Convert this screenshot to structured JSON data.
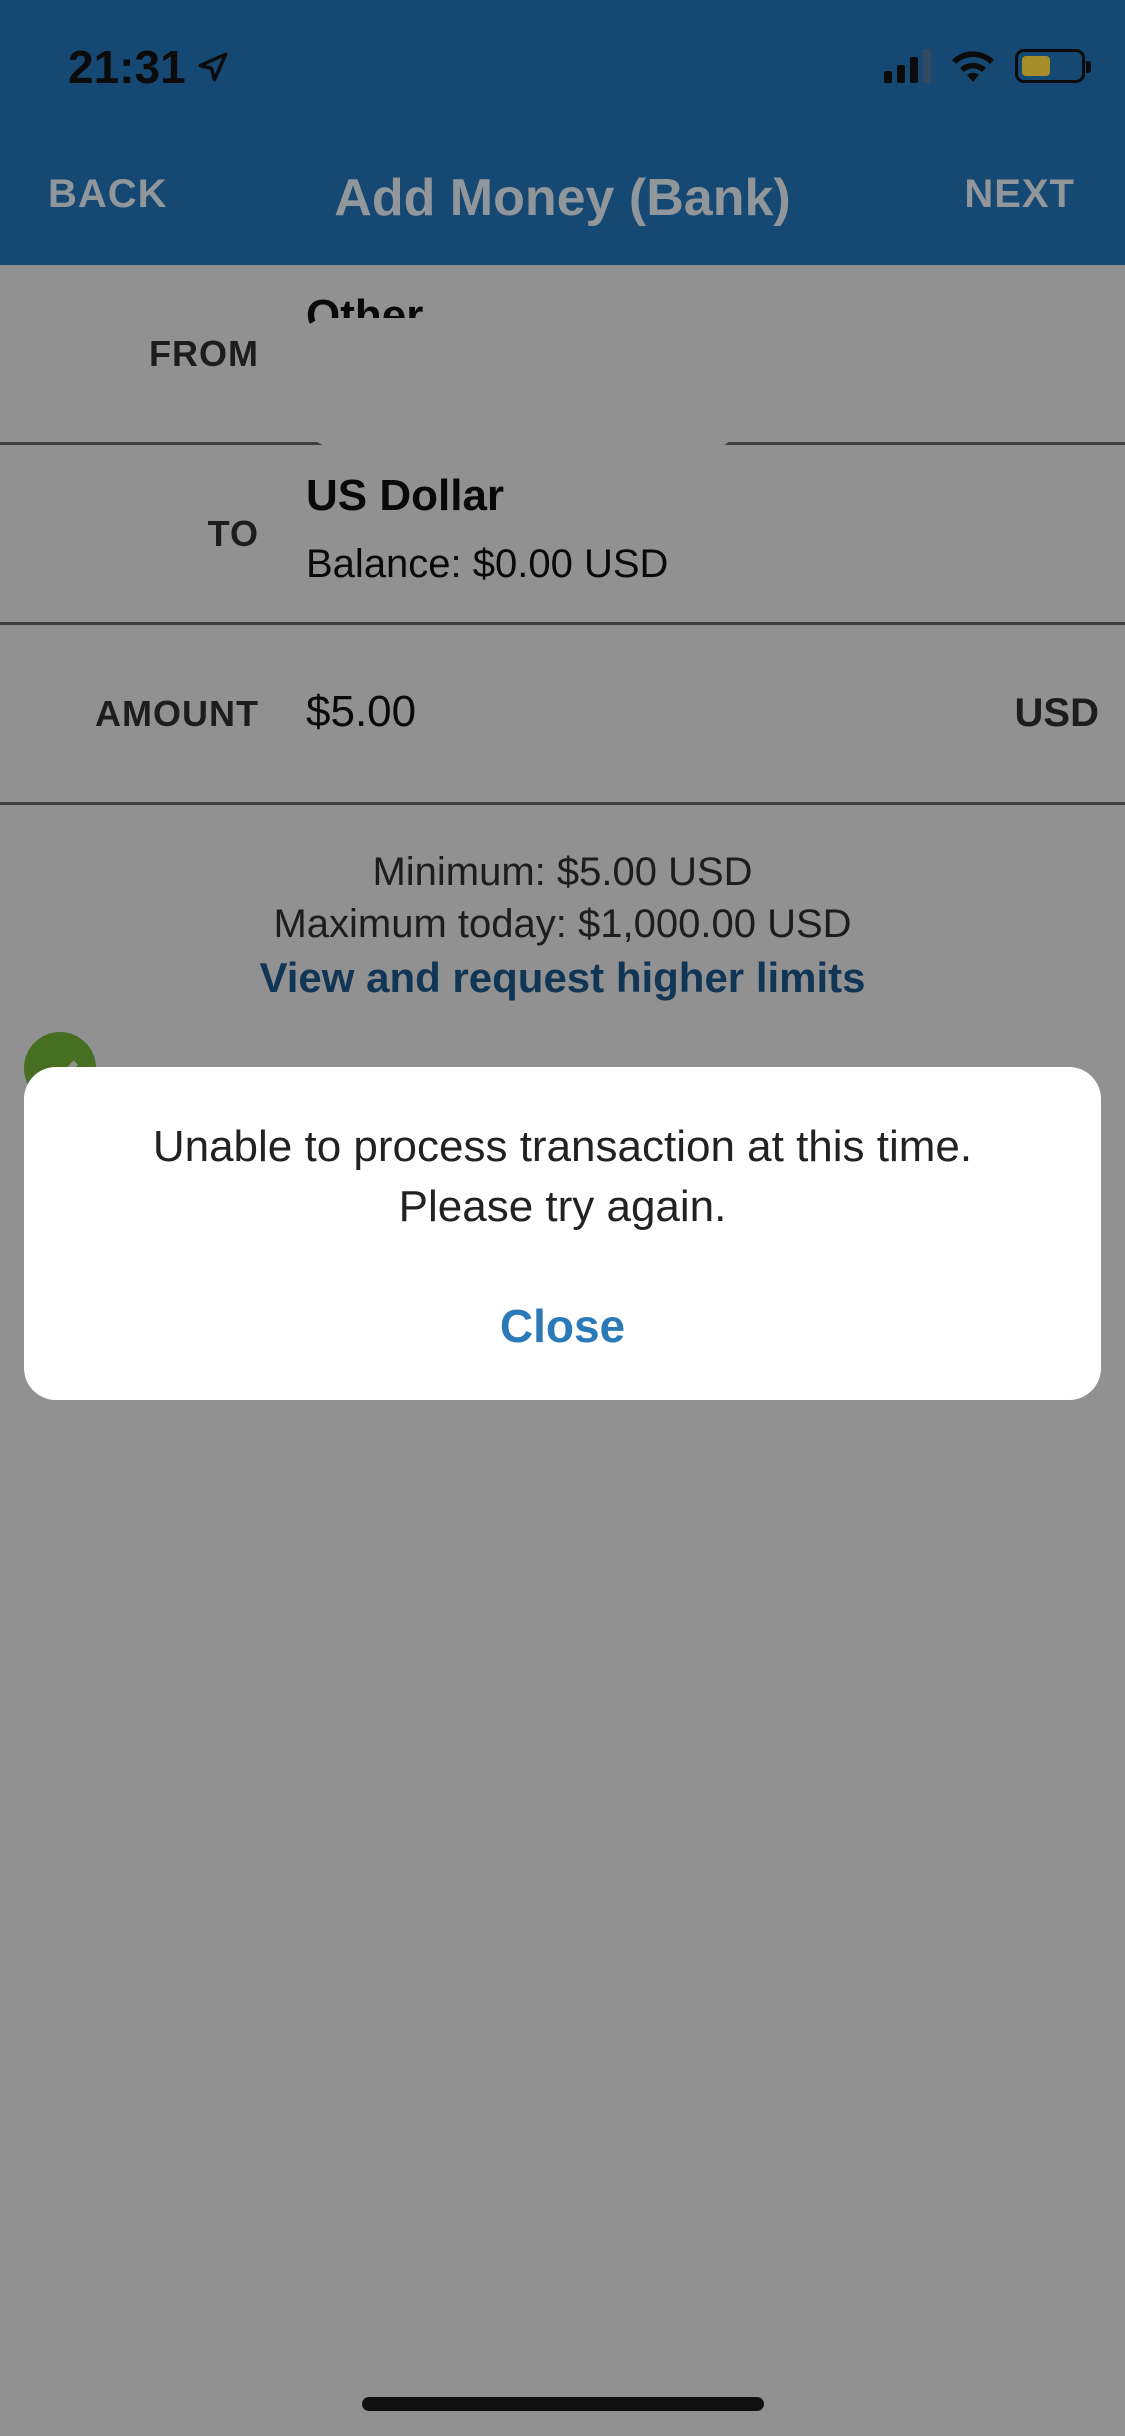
{
  "status_bar": {
    "time": "21:31",
    "location_icon": "location-arrow-icon",
    "signal_icon": "cellular-signal-icon",
    "wifi_icon": "wifi-icon",
    "battery_icon": "battery-icon",
    "battery_color": "#f4d03f"
  },
  "header": {
    "back_label": "BACK",
    "title": "Add Money (Bank)",
    "next_label": "NEXT",
    "background": "#1f6aa8"
  },
  "form": {
    "from": {
      "label": "FROM",
      "value": "Other"
    },
    "to": {
      "label": "TO",
      "value": "US Dollar",
      "balance": "Balance: $0.00 USD"
    },
    "amount": {
      "label": "AMOUNT",
      "value": "$5.00",
      "unit": "USD"
    }
  },
  "limits": {
    "minimum": "Minimum: $5.00 USD",
    "maximum": "Maximum today: $1,000.00 USD",
    "link": "View and request higher limits",
    "link_color": "#1f5d94"
  },
  "dialog": {
    "message_line1": "Unable to process transaction at this time.",
    "message_line2": "Please try again.",
    "close_label": "Close",
    "close_color": "#2b7ab8"
  }
}
